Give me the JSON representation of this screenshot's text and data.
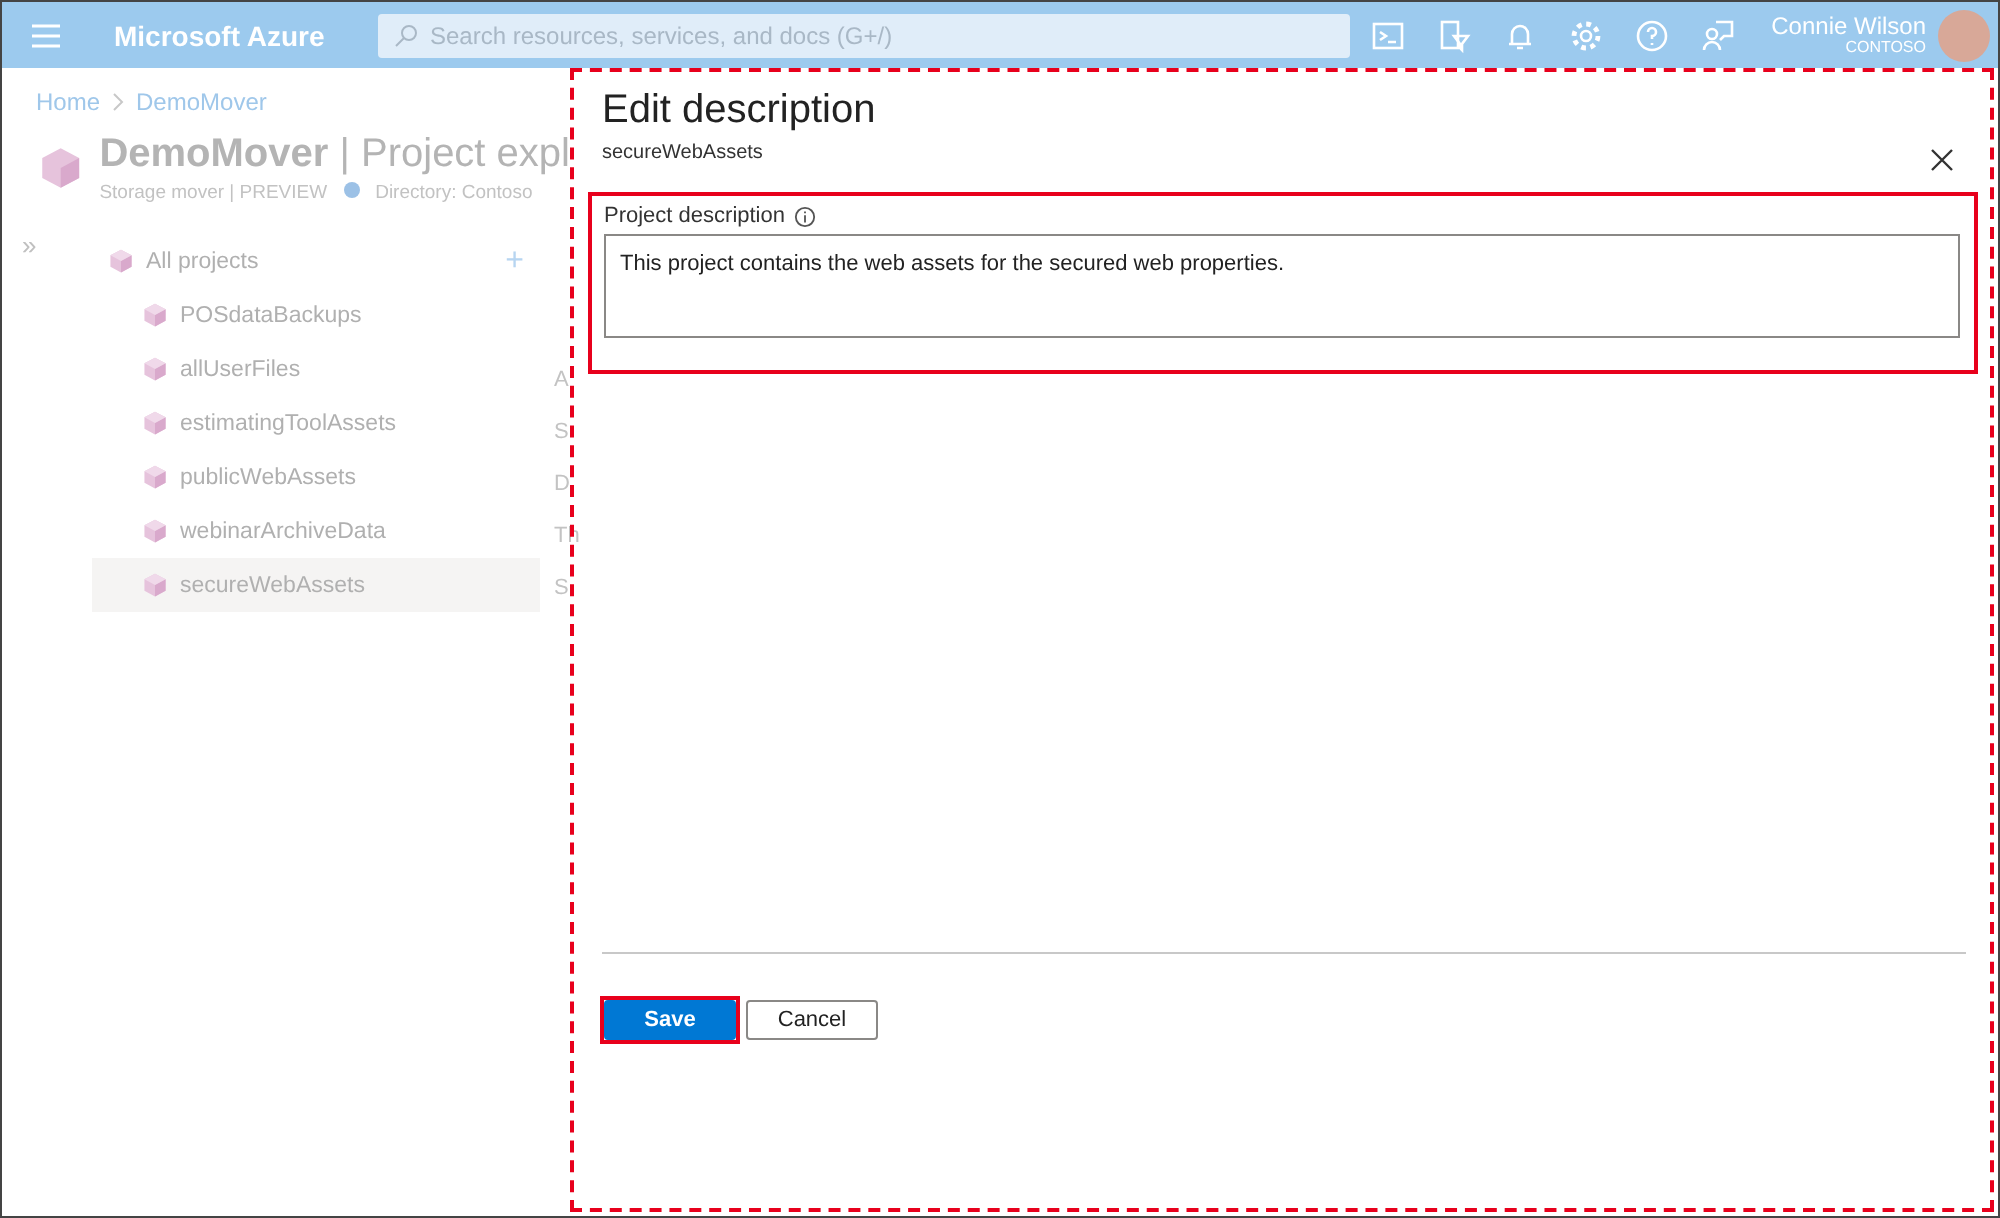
{
  "top_bar": {
    "brand": "Microsoft Azure",
    "search": {
      "placeholder": "Search resources, services, and docs (G+/)"
    },
    "user": {
      "name": "Connie Wilson",
      "tenant": "CONTOSO"
    }
  },
  "breadcrumb": [
    "Home",
    "DemoMover"
  ],
  "collapse": "»",
  "resource": {
    "title": "**DemoMover** | Project expl",
    "type": "Storage mover | PREVIEW",
    "directory": "Directory: Contoso"
  },
  "tree": {
    "root": {
      "label": "All projects",
      "add": "+"
    },
    "children": [
      {
        "label": "POSdataBackups",
        "selected": false
      },
      {
        "label": "allUserFiles",
        "selected": false
      },
      {
        "label": "estimatingToolAssets",
        "selected": false
      },
      {
        "label": "publicWebAssets",
        "selected": false
      },
      {
        "label": "webinarArchiveData",
        "selected": false
      },
      {
        "label": "secureWebAssets",
        "selected": true
      }
    ]
  },
  "peek_texts": [
    "A",
    "S",
    "D",
    "Th",
    "S"
  ],
  "panel": {
    "title": "Edit description",
    "subtitle": "secureWebAssets",
    "field": {
      "label": "Project description",
      "value": "This project contains the web assets for the secured web properties."
    },
    "buttons": [
      {
        "label": "Save",
        "kind": "primary"
      },
      {
        "label": "Cancel",
        "kind": "secondary"
      }
    ]
  }
}
